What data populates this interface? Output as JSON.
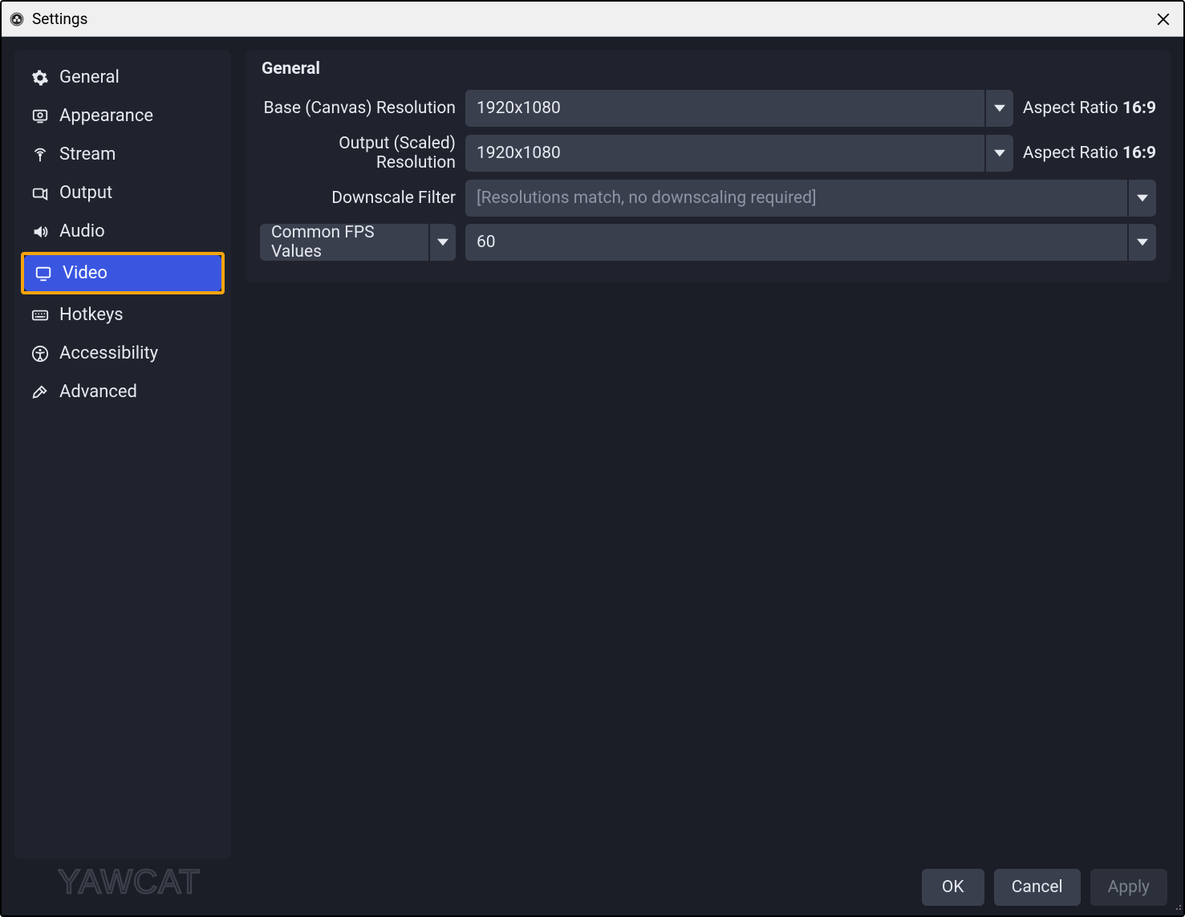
{
  "window": {
    "title": "Settings"
  },
  "sidebar": {
    "items": [
      {
        "label": "General"
      },
      {
        "label": "Appearance"
      },
      {
        "label": "Stream"
      },
      {
        "label": "Output"
      },
      {
        "label": "Audio"
      },
      {
        "label": "Video"
      },
      {
        "label": "Hotkeys"
      },
      {
        "label": "Accessibility"
      },
      {
        "label": "Advanced"
      }
    ],
    "active_index": 5,
    "highlighted_index": 5
  },
  "panel": {
    "section_title": "General",
    "base_res_label": "Base (Canvas) Resolution",
    "base_res_value": "1920x1080",
    "base_aspect_prefix": "Aspect Ratio ",
    "base_aspect_value": "16:9",
    "output_res_label": "Output (Scaled) Resolution",
    "output_res_value": "1920x1080",
    "output_aspect_prefix": "Aspect Ratio ",
    "output_aspect_value": "16:9",
    "downscale_label": "Downscale Filter",
    "downscale_value": "[Resolutions match, no downscaling required]",
    "fps_mode_label": "Common FPS Values",
    "fps_value": "60"
  },
  "footer": {
    "ok": "OK",
    "cancel": "Cancel",
    "apply": "Apply"
  },
  "watermark": "YAWCAT"
}
